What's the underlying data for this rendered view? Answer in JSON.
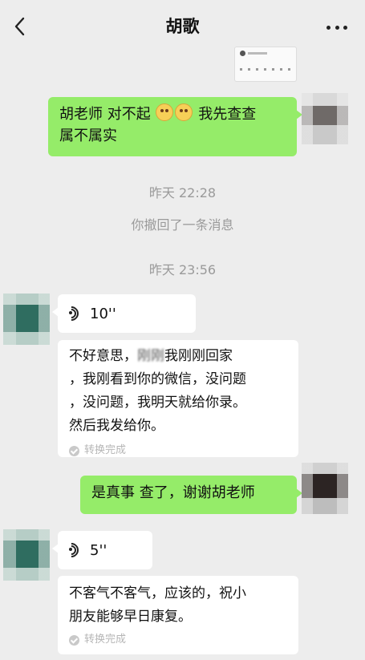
{
  "header": {
    "title": "胡歌",
    "back_icon": "chevron-left-icon",
    "more_icon": "more-dots-icon"
  },
  "messages": {
    "m1": {
      "sender": "me",
      "text_a": "胡老师 对不起",
      "emoji": "pleading-face",
      "text_b": "我先查查",
      "text_c": "属不属实"
    },
    "ts1": "昨天 22:28",
    "recall": "你撤回了一条消息",
    "ts2": "昨天 23:56",
    "v1": {
      "sender": "other",
      "duration": "10''"
    },
    "t1": {
      "line1_a": "不好意思，",
      "line1_blur": "刚刚",
      "line1_b": "我刚刚回家",
      "line2": "，我刚看到你的微信，没问题",
      "line3": "，没问题，我明天就给你录。",
      "line4": "然后我发给你。",
      "status": "转换完成"
    },
    "m2": {
      "sender": "me",
      "text": "是真事 查了，谢谢胡老师"
    },
    "v2": {
      "sender": "other",
      "duration": "5''"
    },
    "t2": {
      "line1": "不客气不客气，应该的，祝小",
      "line2": "朋友能够早日康复。",
      "status": "转换完成"
    }
  },
  "colors": {
    "background": "#ededed",
    "outgoing_bubble": "#95ec69",
    "incoming_bubble": "#ffffff",
    "timestamp": "#9a9a9a"
  }
}
